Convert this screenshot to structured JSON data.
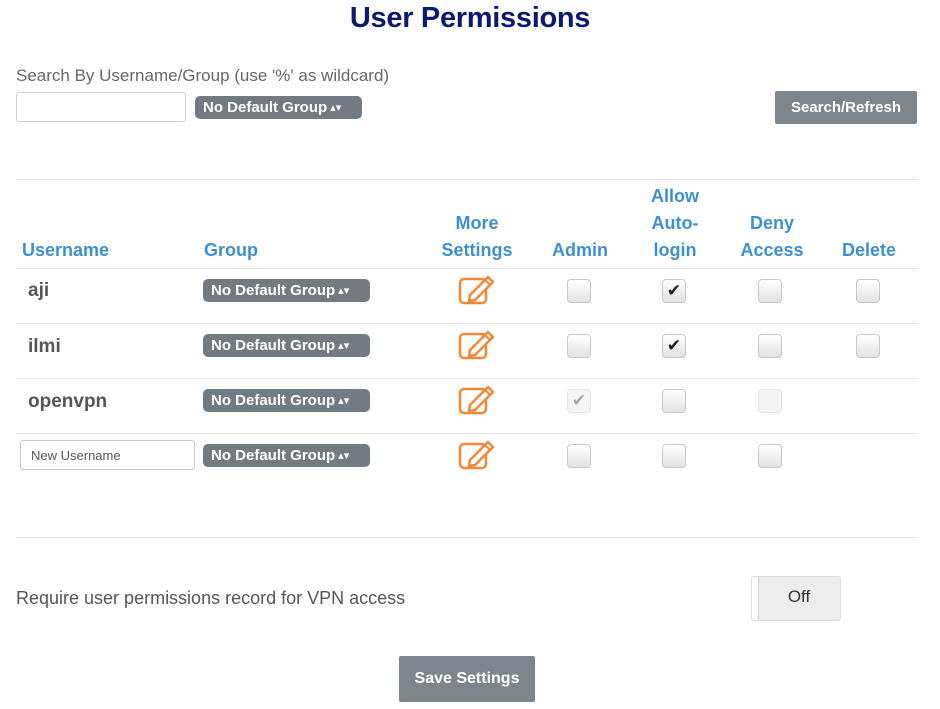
{
  "title": "User Permissions",
  "search": {
    "label": "Search By Username/Group (use '%' as wildcard)",
    "value": "",
    "group_select": "No Default Group",
    "button": "Search/Refresh"
  },
  "table": {
    "headers": {
      "username": "Username",
      "group": "Group",
      "more_settings": [
        "More",
        "Settings"
      ],
      "admin": "Admin",
      "auto_login": [
        "Allow",
        "Auto-",
        "login"
      ],
      "deny_access": [
        "Deny",
        "Access"
      ],
      "delete": "Delete"
    },
    "rows": [
      {
        "username": "aji",
        "group": "No Default Group",
        "admin": false,
        "auto_login": true,
        "deny_access": false,
        "delete": false
      },
      {
        "username": "ilmi",
        "group": "No Default Group",
        "admin": false,
        "auto_login": true,
        "deny_access": false,
        "delete": false
      },
      {
        "username": "openvpn",
        "group": "No Default Group",
        "admin": true,
        "admin_disabled": true,
        "auto_login": false,
        "deny_access": false,
        "deny_disabled": true
      }
    ],
    "new_row": {
      "placeholder": "New Username",
      "group": "No Default Group",
      "admin": false,
      "auto_login": false,
      "deny_access": false
    }
  },
  "require_permissions": {
    "label": "Require user permissions record for VPN access",
    "toggle": "Off"
  },
  "save_button": "Save Settings",
  "colors": {
    "title": "#0c1a6e",
    "header": "#3d8fcf",
    "button": "#7d858c",
    "select": "#737b82",
    "edit_icon": "#f0883a"
  },
  "icons": {
    "edit": "pencil-square-icon",
    "check": "checkmark-icon",
    "select_arrows": "updown-arrows-icon"
  }
}
